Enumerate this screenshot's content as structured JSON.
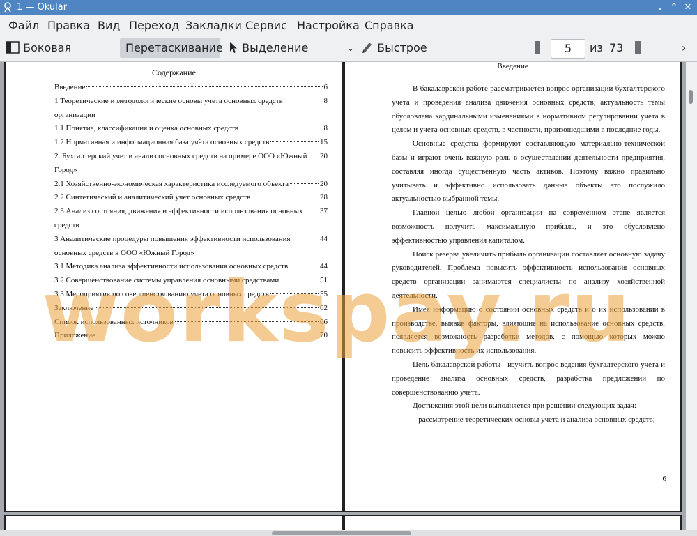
{
  "window": {
    "title": "1 — Okular"
  },
  "menu": [
    "Файл",
    "Правка",
    "Вид",
    "Переход",
    "Закладки",
    "Сервис",
    "Настройка",
    "Справка"
  ],
  "toolbar": {
    "sidebar": "Боковая панель",
    "drag": "Перетаскивание",
    "select_text": "Выделение текста",
    "quick_annotate": "Быстрое комментирование",
    "page_value": "5",
    "of_label": "из",
    "total_pages": "73"
  },
  "toc": {
    "title": "Содержание",
    "entries": [
      {
        "text": "Введение",
        "page": "6"
      },
      {
        "text": "1 Теоретические и методологические основы учета основных средств организации",
        "page": "8"
      },
      {
        "text": "1.1 Понятие, классификация и оценка основных средств",
        "page": "8"
      },
      {
        "text": "1.2 Нормативная и информационная база учёта основных средств",
        "page": "15"
      },
      {
        "text": "2. Бухгалтерский учет и анализ основных средств на примере ООО «Южный Город»",
        "page": "20"
      },
      {
        "text": "2.1 Хозяйственно-экономическая характеристика исследуемого объекта",
        "page": "20"
      },
      {
        "text": "2.2 Синтетический и аналитический учет основных средств",
        "page": "28"
      },
      {
        "text": "2.3 Анализ состояния, движения и эффективности использования основных средств",
        "page": "37"
      },
      {
        "text": "3 Аналитические процедуры повышения эффективности использования основных средств в ООО «Южный Город»",
        "page": "44"
      },
      {
        "text": "3.1 Методика анализа эффективности использования основных средств",
        "page": "44"
      },
      {
        "text": "3.2 Совершенствование системы управления основными средствами",
        "page": "51"
      },
      {
        "text": "3.3 Мероприятия по совершенствованию учета основных средств",
        "page": "55"
      },
      {
        "text": "Заключение",
        "page": "62"
      },
      {
        "text": "Список использованных источников",
        "page": "66"
      },
      {
        "text": "Приложение",
        "page": "70"
      }
    ]
  },
  "intro": {
    "title": "Введение",
    "paragraphs": [
      "В бакалаврской работе рассматривается вопрос организации бухгалтерского учета и проведения анализа движения основных средств, актуальность темы обусловлена кардинальными изменениями в нормативном регулировании учета в целом и учета основных средств, в частности, произошедшими в последние годы.",
      "Основные средства формируют составляющую материально-технической базы и играют очень важную роль в осуществлении деятельности предприятия, составляя иногда существенную часть активов. Поэтому важно правильно учитывать и эффективно использовать данные объекты это послужило актуальностью выбранной темы.",
      "Главной целью любой организации на современном этапе является возможность получить максимальную прибыль, и это обусловлено эффективностью управления капиталом.",
      "Поиск резерва увеличить прибыль организации составляет основную задачу руководителей. Проблема повысить эффективность использования основных средств организации занимаются специалисты по анализу хозяйственной деятельности.",
      "Имея информацию о состоянии основных средств и о их использовании в производстве, выявив факторы, влияющие на использование основных средств, появляется возможность разработки методов, с помощью которых можно повысить эффективность их использования.",
      "Цель бакалаврской работы - изучить вопрос ведения бухгалтерского учета и проведение анализа основных средств, разработка предложений по совершенствованию учета.",
      "Достижения этой цели выполняется при решении следующих задач:"
    ],
    "list_item": "–    рассмотрение теоретических основы учета и анализа основных средств;",
    "page_number": "6"
  },
  "watermark": "workspay.ru",
  "colors": {
    "titlebar": "#4f85c2",
    "watermark": "#eca03c",
    "toolbar_bg": "#eff0f1"
  }
}
